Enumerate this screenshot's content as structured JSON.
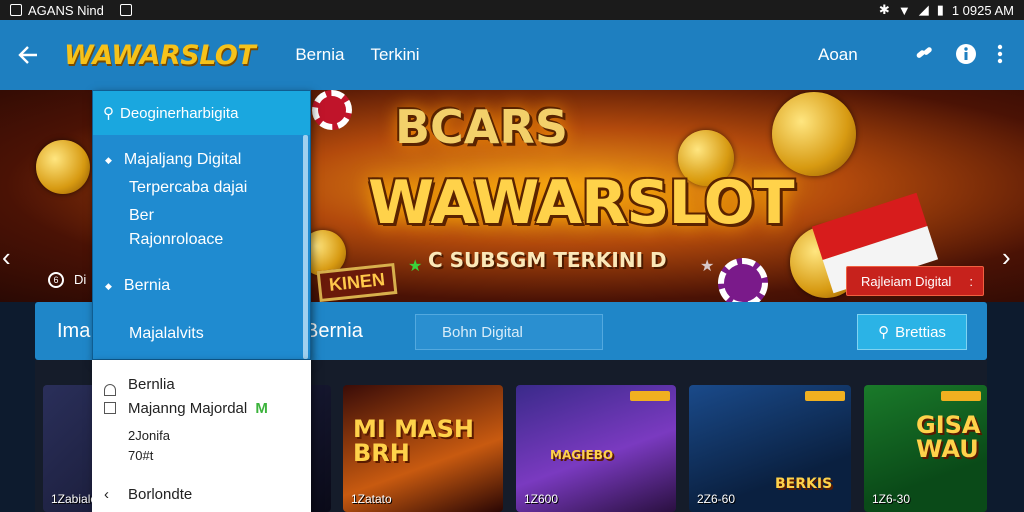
{
  "status_bar": {
    "left_text": "AGANS Nind",
    "time": "1 0925 AM"
  },
  "app_bar": {
    "brand": "WAWARSLOT",
    "nav": [
      "Bernia",
      "Terkini"
    ],
    "account": "Aoan"
  },
  "banner": {
    "logo_top": "BCARS",
    "logo_main": "WAWARSLOT",
    "logo_sub": "C SUBSGM TERKINI D",
    "side_tag": "KINEN",
    "tag_button": "Rajleiam Digital",
    "tag_button_dots": ":",
    "small_label": "Di"
  },
  "category_bar": {
    "label_left": "Ima",
    "label_mid": "Bernia",
    "input_text": "Bohn Digital",
    "button": "Brettias"
  },
  "games": [
    {
      "id": "1Zabiale",
      "art": "",
      "badge": false
    },
    {
      "id": "1Zatato",
      "art": "MI MASH BRH",
      "badge": false
    },
    {
      "id": "1Z600",
      "art": "MAGIEBO",
      "badge": true
    },
    {
      "id": "2Z6-60",
      "art": "BERKIS",
      "badge": true
    },
    {
      "id": "1Z6-30",
      "art": "GISA WAU",
      "badge": true
    }
  ],
  "dropdown": {
    "search": "Deoginerharbigita",
    "items": [
      "Majaljang Digital",
      "Terpercaba dajai",
      "Ber",
      "Rajonroloace",
      "Bernia",
      "Majalalvits"
    ]
  },
  "menu2": {
    "rows": [
      "Bernlia",
      "Majanng Majordal",
      "2Jonifa",
      "70#t",
      "Borlondte"
    ],
    "row2_badge": "M"
  },
  "colors": {
    "appbar": "#1e7fc0",
    "brand": "#f6c21a",
    "accent_red": "#c7221c"
  }
}
